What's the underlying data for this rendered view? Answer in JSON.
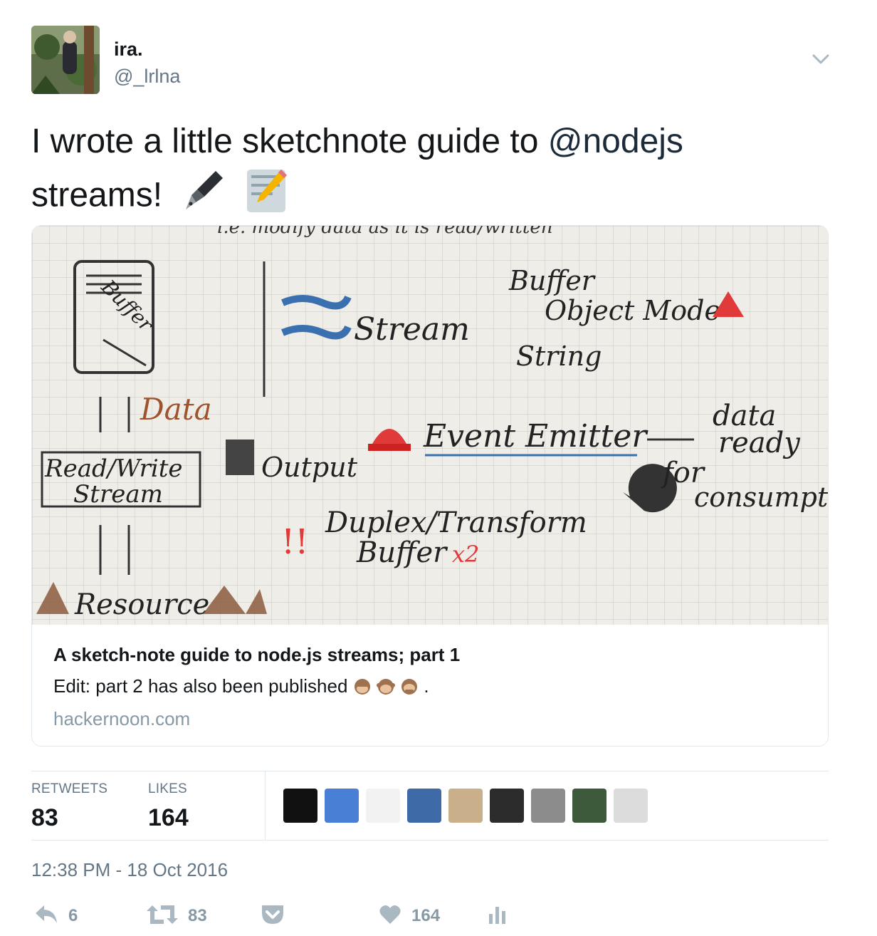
{
  "tweet": {
    "display_name": "ira.",
    "handle": "@_lrlna",
    "text_part1": "I wrote a little sketchnote guide to ",
    "mention": "@nodejs",
    "text_part2": "streams!",
    "emojis": [
      "black-nib-emoji",
      "memo-emoji"
    ]
  },
  "card": {
    "title": "A sketch-note guide to node.js streams; part 1",
    "description": "Edit: part 2 has also been published",
    "description_emojis": [
      "see-no-evil-monkey",
      "hear-no-evil-monkey",
      "speak-no-evil-monkey"
    ],
    "description_end": ".",
    "domain": "hackernoon.com",
    "image_text": {
      "top": "i.e. modify data as it is read/written",
      "buffer_box": "Buffer",
      "stream": "Stream",
      "buffer": "Buffer",
      "object_mode": "Object Mode",
      "string": "String",
      "data": "Data",
      "read_write": "Read/Write",
      "stream_box": "Stream",
      "output": "Output",
      "event_emitter": "Event Emitter",
      "data_ready": "data",
      "ready": "ready",
      "for": "for",
      "consumption": "consumptio",
      "exclaim": "!!",
      "duplex": "Duplex/Transform",
      "buffer_x2": "Buffer",
      "x2": "x2",
      "resource": "Resource"
    }
  },
  "stats": {
    "retweets_label": "RETWEETS",
    "retweets_value": "83",
    "likes_label": "LIKES",
    "likes_value": "164",
    "likers": [
      "#111111",
      "#4a7fd6",
      "#f2f2f2",
      "#3f6aa8",
      "#c9b08a",
      "#2c2c2c",
      "#8c8c8c",
      "#3d5a3a",
      "#dcdcdc"
    ]
  },
  "timestamp": "12:38 PM - 18 Oct 2016",
  "actions": {
    "reply_count": "6",
    "retweet_count": "83",
    "like_count": "164"
  },
  "colors": {
    "text": "#14171a",
    "muted": "#657786",
    "icon": "#aab8c2",
    "border": "#e1e8ed"
  }
}
